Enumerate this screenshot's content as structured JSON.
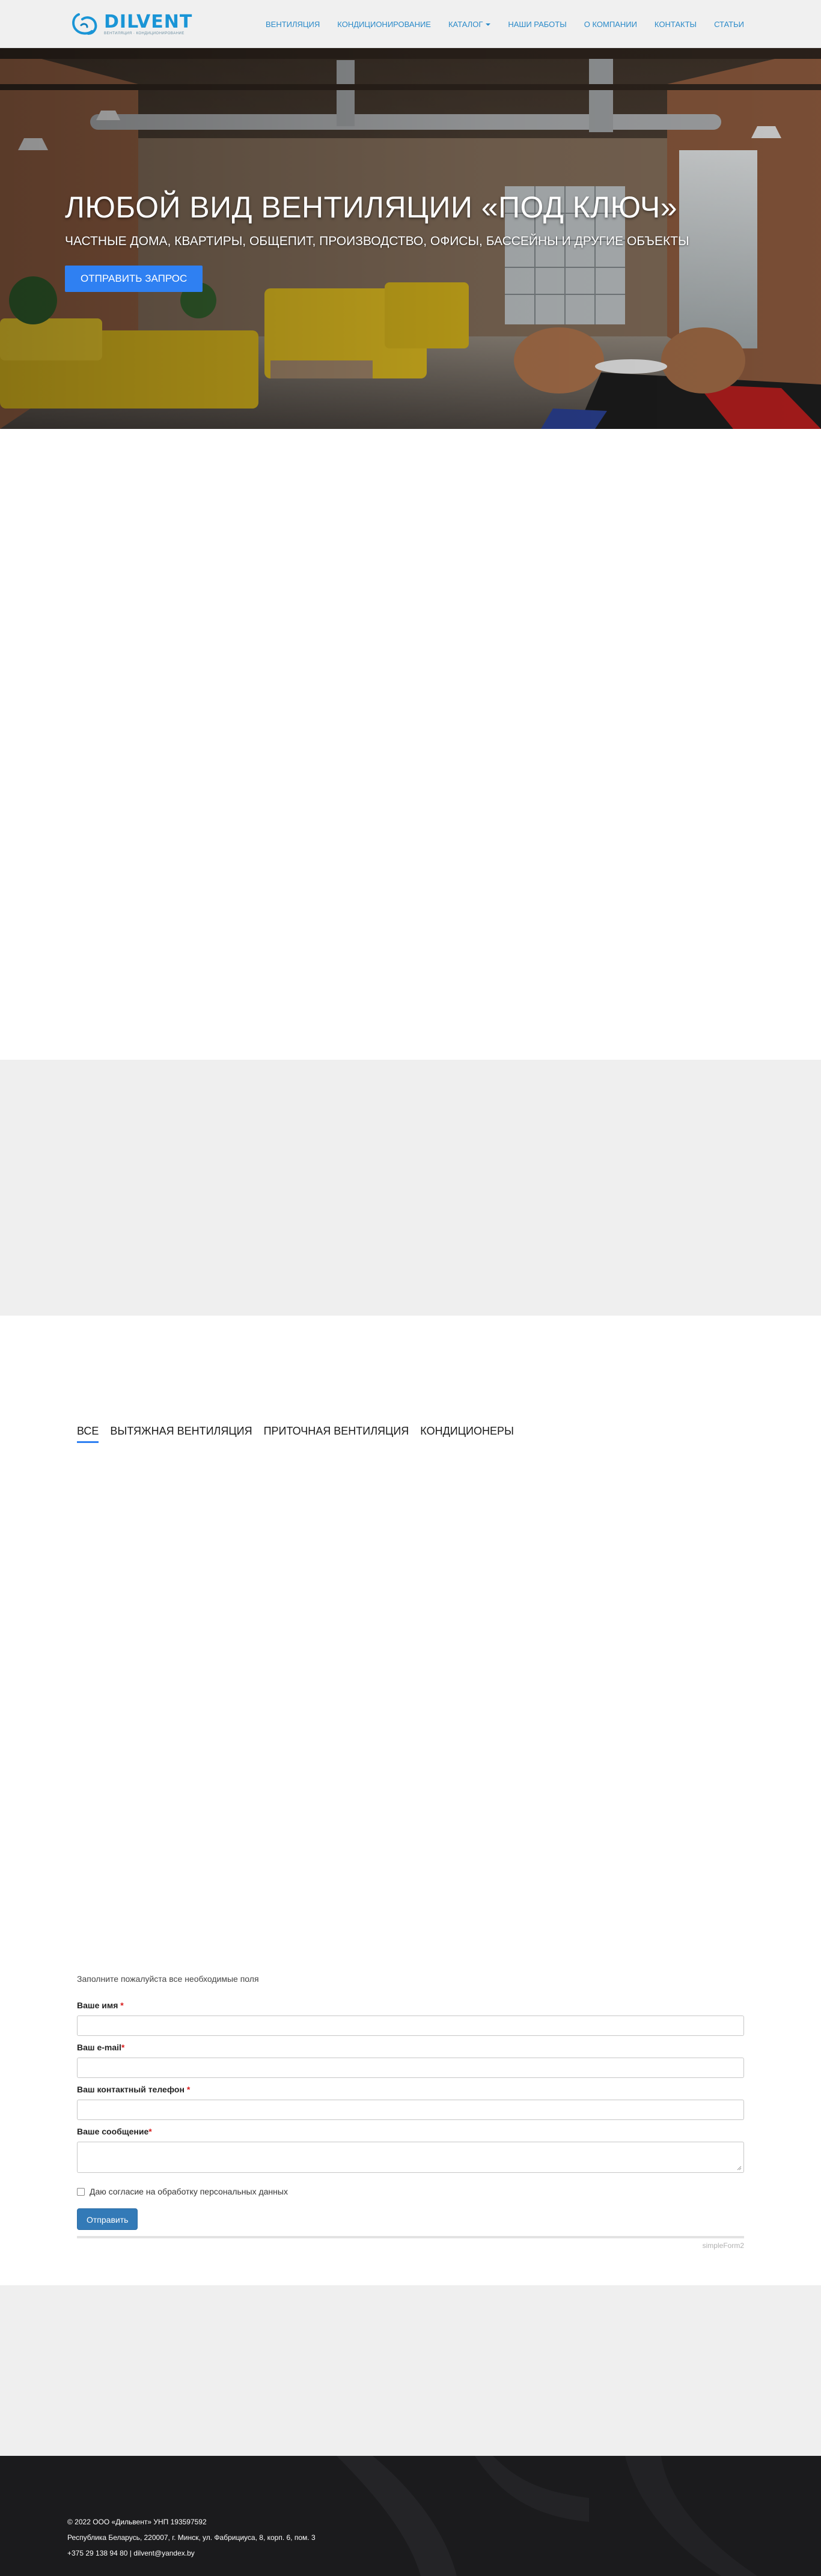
{
  "header": {
    "logo": {
      "name": "DILVENT",
      "tagline": "ВЕНТИЛЯЦИЯ · КОНДИЦИОНИРОВАНИЕ"
    },
    "nav": [
      {
        "label": "ВЕНТИЛЯЦИЯ"
      },
      {
        "label": "КОНДИЦИОНИРОВАНИЕ"
      },
      {
        "label": "КАТАЛОГ",
        "has_dropdown": true
      },
      {
        "label": "НАШИ РАБОТЫ"
      },
      {
        "label": "О КОМПАНИИ"
      },
      {
        "label": "КОНТАКТЫ"
      },
      {
        "label": "СТАТЬИ"
      }
    ]
  },
  "hero": {
    "title": "ЛЮБОЙ ВИД ВЕНТИЛЯЦИИ «ПОД КЛЮЧ»",
    "subtitle": "ЧАСТНЫЕ ДОМА, КВАРТИРЫ, ОБЩЕПИТ, ПРОИЗВОДСТВО, ОФИСЫ, БАССЕЙНЫ И ДРУГИЕ ОБЪЕКТЫ",
    "button_label": "ОТПРАВИТЬ ЗАПРОС"
  },
  "portfolio": {
    "tabs": [
      {
        "label": "ВСЕ",
        "active": true
      },
      {
        "label": "ВЫТЯЖНАЯ ВЕНТИЛЯЦИЯ",
        "active": false
      },
      {
        "label": "ПРИТОЧНАЯ ВЕНТИЛЯЦИЯ",
        "active": false
      },
      {
        "label": "КОНДИЦИОНЕРЫ",
        "active": false
      }
    ]
  },
  "form": {
    "note": "Заполните пожалуйста все необходимые поля",
    "fields": [
      {
        "label": "Ваше имя",
        "required_mark": "*",
        "value": ""
      },
      {
        "label": "Ваш e-mail",
        "required_mark": "*",
        "value": ""
      },
      {
        "label": "Ваш контактный телефон",
        "required_mark": "*",
        "value": ""
      },
      {
        "label": "Ваше сообщение",
        "required_mark": "*",
        "value": ""
      }
    ],
    "consent_label": "Даю согласие на обработку персональных данных",
    "consent_checked": false,
    "submit_label": "Отправить",
    "credit": "simpleForm2"
  },
  "footer": {
    "lines": [
      "© 2022 ООО «Дильвент» УНП 193597592",
      "Республика Беларусь, 220007, г. Минск, ул. Фабрициуса, 8, корп. 6, пом. 3",
      "+375 29 138 94 80 | dilvent@yandex.by"
    ]
  },
  "colors": {
    "brand": "#1a95d6",
    "nav_link": "#2a8ac9",
    "hero_button": "#2f80f2",
    "submit_button": "#337ab7",
    "footer_bg": "#1b1b1d",
    "section_gray": "#efefef"
  }
}
